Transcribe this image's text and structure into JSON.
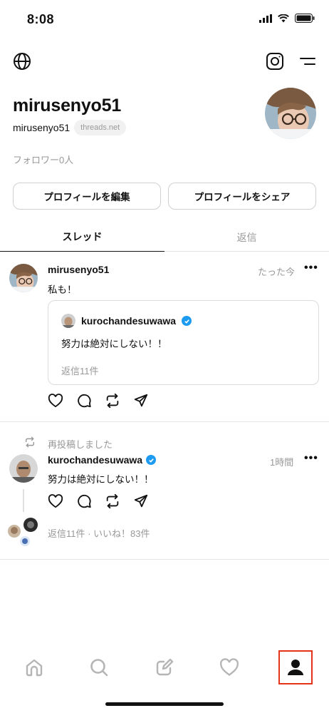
{
  "status_bar": {
    "time": "8:08"
  },
  "profile": {
    "name": "mirusenyo51",
    "handle": "mirusenyo51",
    "domain": "threads.net",
    "followers": "フォロワー0人"
  },
  "buttons": {
    "edit": "プロフィールを編集",
    "share": "プロフィールをシェア"
  },
  "tabs": [
    {
      "label": "スレッド",
      "active": true
    },
    {
      "label": "返信",
      "active": false
    }
  ],
  "posts": [
    {
      "user": "mirusenyo51",
      "time": "たった今",
      "text": "私も！",
      "quote": {
        "user": "kurochandesuwawa",
        "verified": true,
        "text": "努力は絶対にしない！！",
        "meta": "返信11件"
      }
    },
    {
      "repost_label": "再投稿しました",
      "user": "kurochandesuwawa",
      "verified": true,
      "time": "1時間",
      "text": "努力は絶対にしない！！",
      "meta": "返信11件 · いいね！83件"
    }
  ],
  "more_label": "•••",
  "nav": [
    "home-icon",
    "search-icon",
    "compose-icon",
    "activity-heart-icon",
    "profile-icon"
  ],
  "colors": {
    "accent_highlight": "#e53319",
    "verified": "#1d9bf0",
    "muted": "#999999"
  }
}
